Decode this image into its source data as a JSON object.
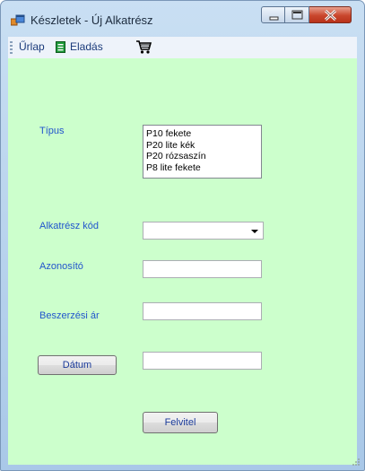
{
  "window": {
    "title": "Készletek - Új Alkatrész"
  },
  "menu": {
    "items": [
      {
        "label": "Űrlap"
      },
      {
        "label": "Eladás"
      }
    ]
  },
  "form": {
    "tipus_label": "Típus",
    "tipus_options": [
      "P10 fekete",
      "P20 lite kék",
      "P20 rózsaszín",
      "P8 lite fekete"
    ],
    "kod_label": "Alkatrész kód",
    "kod_value": "",
    "azonosito_label": "Azonosító",
    "azonosito_value": "",
    "ar_label": "Beszerzési ár",
    "ar_value": "",
    "datum_button": "Dátum",
    "datum_value": "",
    "submit_button": "Felvitel"
  },
  "colors": {
    "form_background": "#ccffcc",
    "label_text": "#2255cc"
  }
}
